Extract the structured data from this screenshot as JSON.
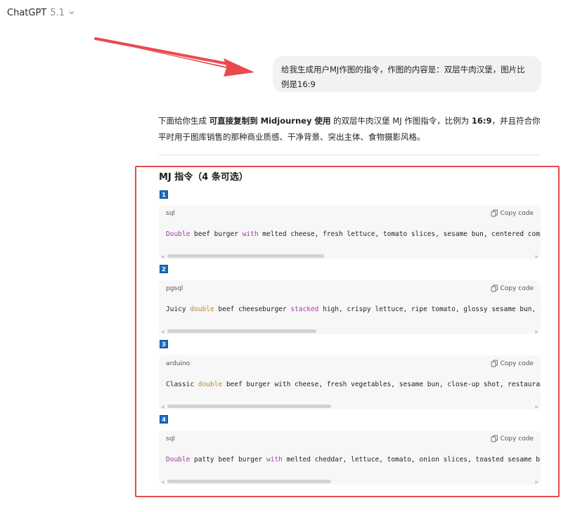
{
  "header": {
    "model_name": "ChatGPT",
    "model_version": "5.1"
  },
  "user_message": "给我生成用户MJ作图的指令，作图的内容是：双层牛肉汉堡，图片比例是16:9",
  "assistant": {
    "intro_parts": [
      "下面给你生成 ",
      "可直接复制到 Midjourney 使用",
      " 的双层牛肉汉堡 MJ 作图指令，比例为 ",
      "16:9",
      "，并且符合你平时用于图库销售的那种商业质感、干净背景、突出主体、食物摄影风格。"
    ],
    "section_title": "MJ 指令（4 条可选）",
    "copy_label": "Copy code",
    "blocks": [
      {
        "number": "1",
        "language": "sql",
        "tokens": [
          {
            "text": "Double",
            "style": "purple"
          },
          {
            "text": " beef burger ",
            "style": "plain"
          },
          {
            "text": "with",
            "style": "purple"
          },
          {
            "text": " melted cheese, fresh lettuce, tomato slices, sesame bun, centered composit",
            "style": "plain"
          }
        ],
        "scroll_fraction": 0.42
      },
      {
        "number": "2",
        "language": "pgsql",
        "tokens": [
          {
            "text": "Juicy ",
            "style": "plain"
          },
          {
            "text": "double",
            "style": "gold"
          },
          {
            "text": " beef cheeseburger ",
            "style": "plain"
          },
          {
            "text": "stacked",
            "style": "purple"
          },
          {
            "text": " high, crispy lettuce, ripe tomato, glossy sesame bun, isola",
            "style": "plain"
          }
        ],
        "scroll_fraction": 0.4
      },
      {
        "number": "3",
        "language": "arduino",
        "tokens": [
          {
            "text": "Classic ",
            "style": "plain"
          },
          {
            "text": "double",
            "style": "gold"
          },
          {
            "text": " beef burger with cheese, fresh vegetables, sesame bun, close-up shot, restaurant pr",
            "style": "plain"
          }
        ],
        "scroll_fraction": 0.44
      },
      {
        "number": "4",
        "language": "sql",
        "tokens": [
          {
            "text": "Double",
            "style": "purple"
          },
          {
            "text": " patty beef burger ",
            "style": "plain"
          },
          {
            "text": "with",
            "style": "purple"
          },
          {
            "text": " melted cheddar, lettuce, tomato, onion slices, toasted sesame bun, c",
            "style": "plain"
          }
        ],
        "scroll_fraction": 0.44
      }
    ]
  },
  "colors": {
    "annotation_red": "#e84a4f",
    "keyword_purple": "#a23ba7",
    "keyword_gold": "#b9892b",
    "badge_blue": "#1e6fc0"
  }
}
